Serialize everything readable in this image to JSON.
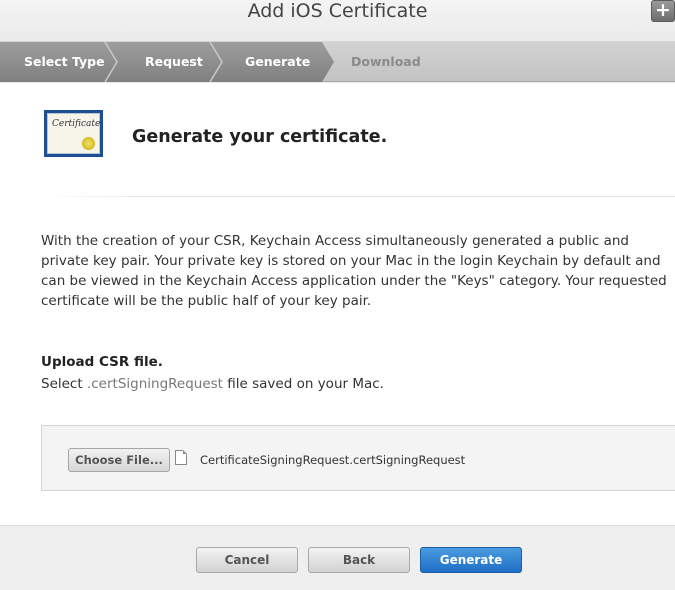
{
  "window": {
    "title": "Add iOS Certificate",
    "add_label": "+"
  },
  "steps": [
    {
      "label": "Select Type",
      "state": "done"
    },
    {
      "label": "Request",
      "state": "done"
    },
    {
      "label": "Generate",
      "state": "current"
    },
    {
      "label": "Download",
      "state": "pending"
    }
  ],
  "header": {
    "icon_text": "Certificate",
    "title": "Generate your certificate."
  },
  "description": "With the creation of your CSR, Keychain Access simultaneously generated a public and private key pair. Your private key is stored on your Mac in the login Keychain by default and can be viewed in the Keychain Access application under the \"Keys\" category. Your requested certificate will be the public half of your key pair.",
  "upload": {
    "title": "Upload CSR file.",
    "desc_prefix": "Select ",
    "desc_code": ".certSigningRequest",
    "desc_suffix": " file saved on your Mac.",
    "choose_label": "Choose File...",
    "file_name": "CertificateSigningRequest.certSigningRequest"
  },
  "footer": {
    "cancel_label": "Cancel",
    "back_label": "Back",
    "generate_label": "Generate"
  },
  "colors": {
    "accent": "#1f6fc6",
    "step_done": "#8e8e8e",
    "step_pending": "#c9c9c9"
  }
}
